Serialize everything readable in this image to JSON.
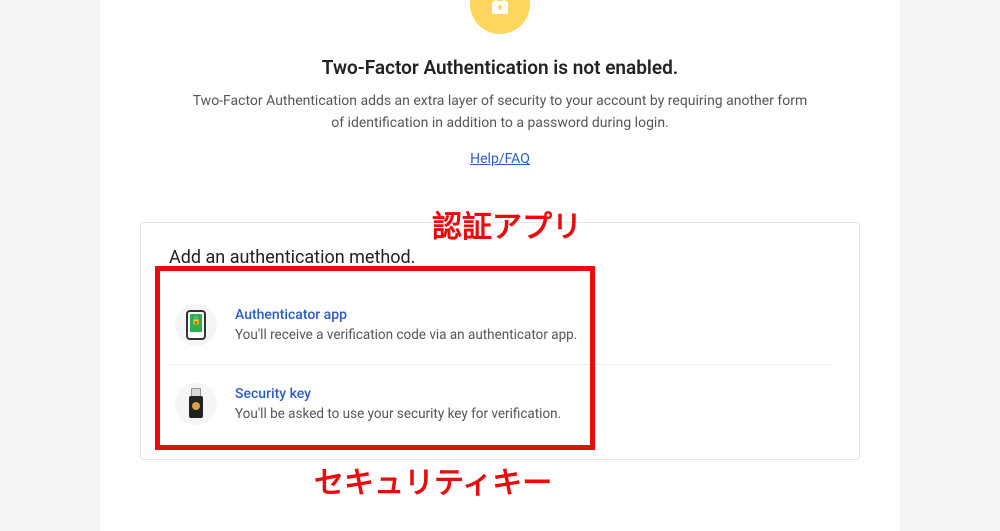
{
  "icon": {
    "name": "lock-icon",
    "bg_color": "#ffd75e"
  },
  "heading": "Two-Factor Authentication is not enabled.",
  "description": "Two-Factor Authentication adds an extra layer of security to your account by requiring another form of identification in addition to a password during login.",
  "help_link": {
    "label": "Help/FAQ"
  },
  "card": {
    "title": "Add an authentication method.",
    "methods": [
      {
        "id": "authenticator-app",
        "icon": "phone-authenticator-icon",
        "title": "Authenticator app",
        "description": "You'll receive a verification code via an authenticator app."
      },
      {
        "id": "security-key",
        "icon": "usb-key-icon",
        "title": "Security key",
        "description": "You'll be asked to use your security key for verification."
      }
    ]
  },
  "annotations": {
    "box_color": "#e80c0c",
    "label_top": "認証アプリ",
    "label_bottom": "セキュリティキー"
  }
}
